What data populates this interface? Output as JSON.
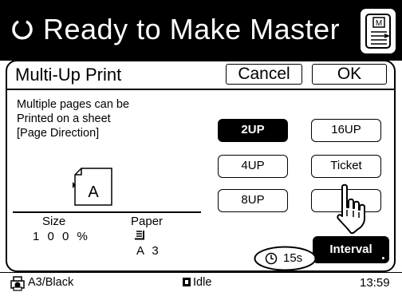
{
  "header": {
    "status_text": "Ready to Make Master",
    "status_icon": "refresh-arc-icon",
    "master_button_icon": "master-document-icon"
  },
  "panel": {
    "title": "Multi-Up Print",
    "cancel_label": "Cancel",
    "ok_label": "OK",
    "description": [
      "Multiple pages can be",
      "Printed on a sheet",
      "[Page Direction]"
    ],
    "page_direction_letter": "A",
    "size_label": "Size",
    "size_value": "1 0 0 %",
    "paper_label": "Paper",
    "paper_value": "A 3",
    "options": {
      "2up": "2UP",
      "16up": "16UP",
      "4up": "4UP",
      "ticket": "Ticket",
      "8up": "8UP",
      "blank": ""
    },
    "selected_option": "2UP",
    "interval_label": "Interval",
    "timer_text": "15s"
  },
  "statusbar": {
    "paper_color": "A3/Black",
    "machine_state": "Idle",
    "time": "13:59"
  },
  "colors": {
    "background": "#ffffff",
    "header_bg": "#000000",
    "selected_bg": "#000000",
    "text": "#000000"
  }
}
